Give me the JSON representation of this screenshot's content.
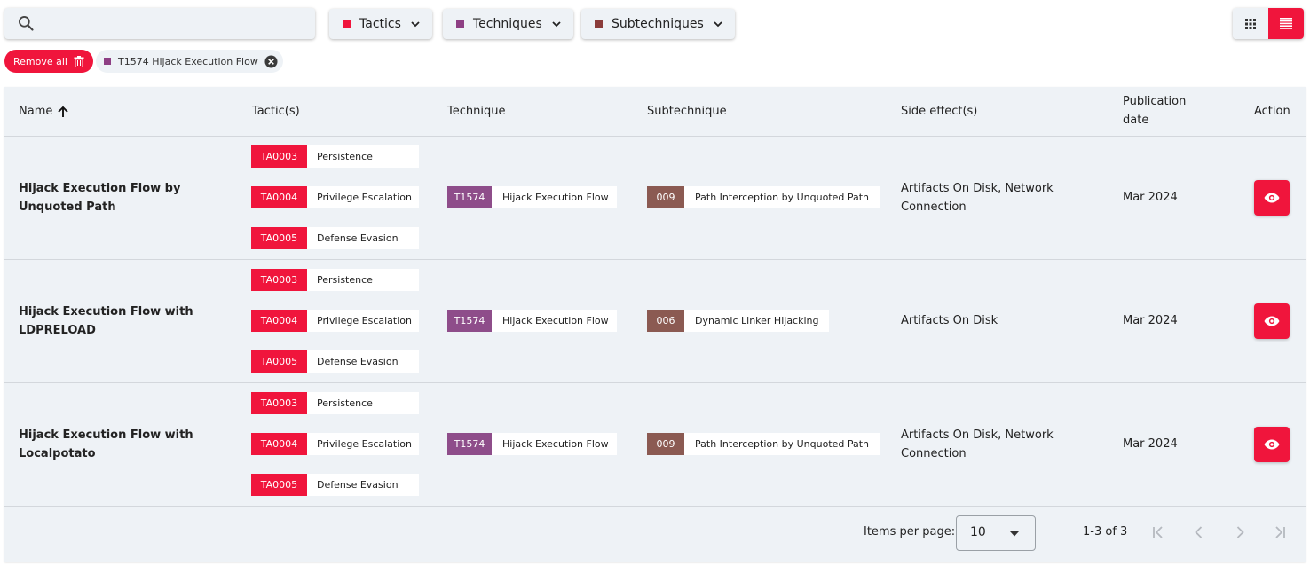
{
  "search": {
    "placeholder": "",
    "value": ""
  },
  "filters": [
    {
      "label": "Tactics",
      "color": "#f0153c"
    },
    {
      "label": "Techniques",
      "color": "#8e3f84"
    },
    {
      "label": "Subtechniques",
      "color": "#8b3c3a"
    }
  ],
  "view_toggle": {
    "active": "list",
    "options": [
      "grid",
      "list"
    ]
  },
  "chips": {
    "remove_all_label": "Remove all",
    "active": [
      {
        "label": "T1574 Hijack Execution Flow",
        "color": "#8e3f84"
      }
    ]
  },
  "table": {
    "columns": {
      "name": "Name",
      "tactics": "Tactic(s)",
      "technique": "Technique",
      "subtechnique": "Subtechnique",
      "side_effects": "Side effect(s)",
      "publication_date_line1": "Publication",
      "publication_date_line2": "date",
      "action": "Action"
    },
    "sort": {
      "column": "name",
      "direction": "ascending"
    },
    "rows": [
      {
        "name": "Hijack Execution Flow by Unquoted Path",
        "tactics": [
          {
            "code": "TA0003",
            "label": "Persistence"
          },
          {
            "code": "TA0004",
            "label": "Privilege Escalation"
          },
          {
            "code": "TA0005",
            "label": "Defense Evasion"
          }
        ],
        "technique": {
          "code": "T1574",
          "label": "Hijack Execution Flow"
        },
        "subtechnique": {
          "code": "009",
          "label": "Path Interception by Unquoted Path"
        },
        "side_effects": "Artifacts On Disk, Network Connection",
        "publication_date": "Mar 2024"
      },
      {
        "name": "Hijack Execution Flow with LDPRELOAD",
        "tactics": [
          {
            "code": "TA0003",
            "label": "Persistence"
          },
          {
            "code": "TA0004",
            "label": "Privilege Escalation"
          },
          {
            "code": "TA0005",
            "label": "Defense Evasion"
          }
        ],
        "technique": {
          "code": "T1574",
          "label": "Hijack Execution Flow"
        },
        "subtechnique": {
          "code": "006",
          "label": "Dynamic Linker Hijacking"
        },
        "side_effects": "Artifacts On Disk",
        "publication_date": "Mar 2024"
      },
      {
        "name": "Hijack Execution Flow with Localpotato",
        "tactics": [
          {
            "code": "TA0003",
            "label": "Persistence"
          },
          {
            "code": "TA0004",
            "label": "Privilege Escalation"
          },
          {
            "code": "TA0005",
            "label": "Defense Evasion"
          }
        ],
        "technique": {
          "code": "T1574",
          "label": "Hijack Execution Flow"
        },
        "subtechnique": {
          "code": "009",
          "label": "Path Interception by Unquoted Path"
        },
        "side_effects": "Artifacts On Disk, Network Connection",
        "publication_date": "Mar 2024"
      }
    ]
  },
  "paginator": {
    "items_per_page_label": "Items per page:",
    "items_per_page_value": "10",
    "range_label": "1-3 of 3"
  },
  "icons": {
    "search": "search-icon",
    "chevron": "chevron-down-icon",
    "grid": "grid-view-icon",
    "list": "list-view-icon",
    "trash": "trash-icon",
    "close": "close-circle-icon",
    "sort": "arrow-up-icon",
    "view": "eye-icon",
    "first": "first-page-icon",
    "prev": "chevron-left-icon",
    "next": "chevron-right-icon",
    "last": "last-page-icon"
  }
}
